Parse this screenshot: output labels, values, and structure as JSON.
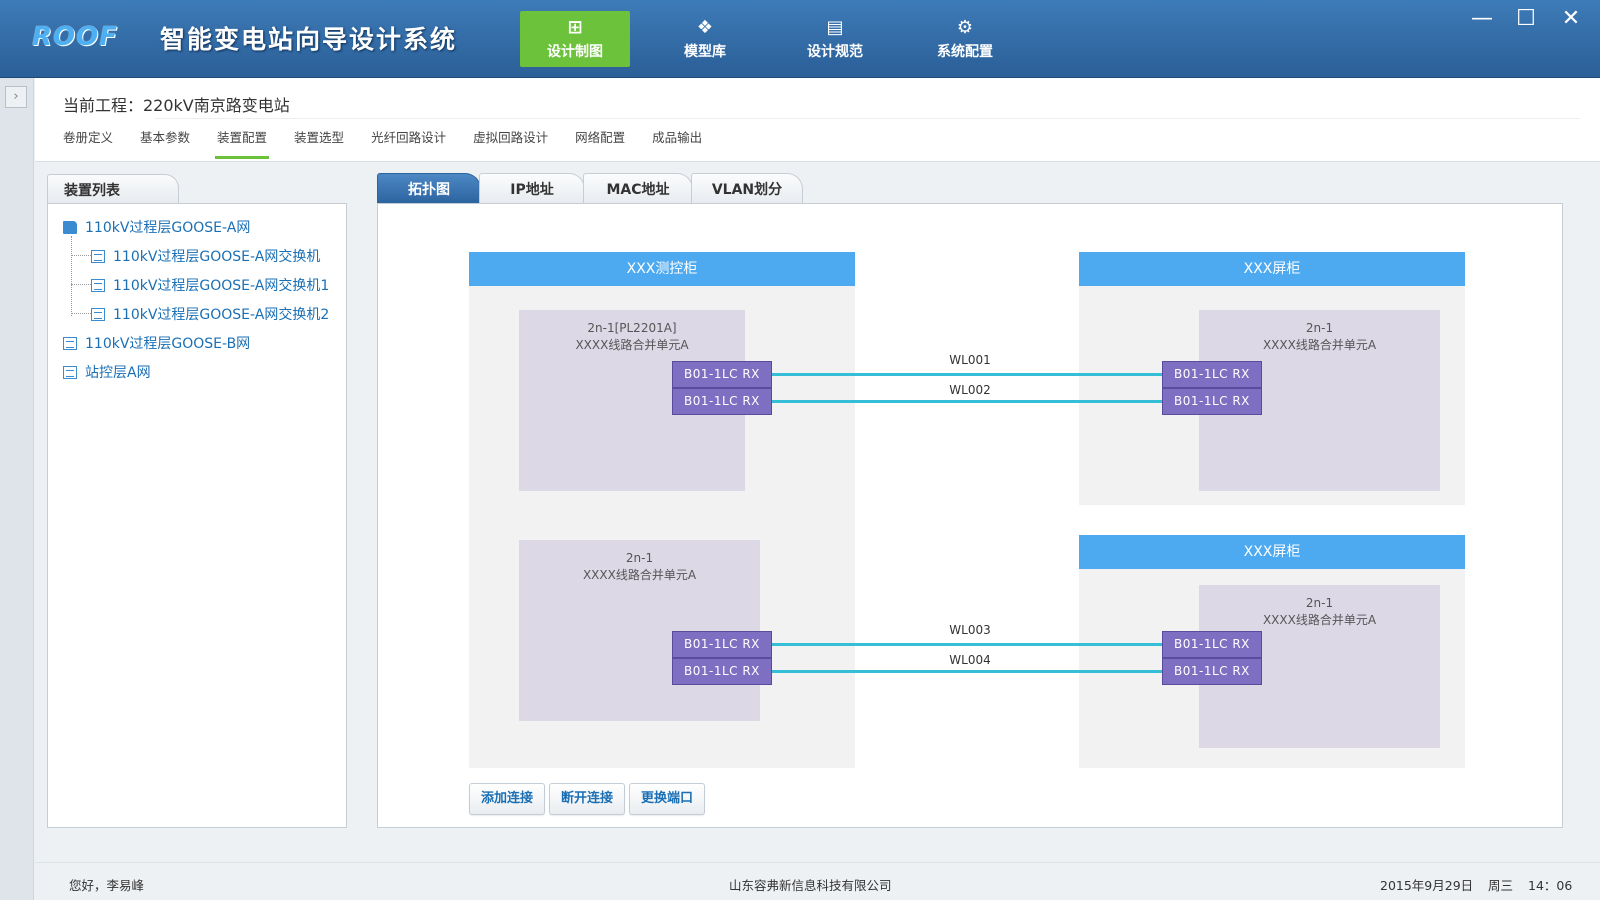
{
  "app": {
    "logo": "ROOF",
    "title": "智能变电站向导设计系统"
  },
  "nav": [
    {
      "label": "设计制图",
      "icon": "design-drawing-icon",
      "glyph": "⊞",
      "active": true
    },
    {
      "label": "模型库",
      "icon": "dropbox-icon",
      "glyph": "❖",
      "active": false
    },
    {
      "label": "设计规范",
      "icon": "document-icon",
      "glyph": "▤",
      "active": false
    },
    {
      "label": "系统配置",
      "icon": "gear-icon",
      "glyph": "⚙",
      "active": false
    }
  ],
  "window_controls": {
    "minimize": "—",
    "maximize": "☐",
    "close": "✕"
  },
  "sidebar_toggle": "›",
  "project": {
    "label": "当前工程：220kV南京路变电站"
  },
  "subtabs": [
    "卷册定义",
    "基本参数",
    "装置配置",
    "装置选型",
    "光纤回路设计",
    "虚拟回路设计",
    "网络配置",
    "成品输出"
  ],
  "subtab_active": "装置配置",
  "left_panel": {
    "title": "装置列表",
    "tree": [
      "110kV过程层GOOSE-A网",
      "110kV过程层GOOSE-A网交换机",
      "110kV过程层GOOSE-A网交换机1",
      "110kV过程层GOOSE-A网交换机2",
      "110kV过程层GOOSE-B网",
      "站控层A网"
    ]
  },
  "right_tabs": [
    "拓扑图",
    "IP地址",
    "MAC地址",
    "VLAN划分"
  ],
  "right_tab_active": "拓扑图",
  "diagram": {
    "cabinets": [
      "XXX测控柜",
      "XXX屏柜",
      "XXX屏柜"
    ],
    "devices": [
      {
        "line1": "2n-1[PL2201A]",
        "line2": "XXXX线路合并单元A"
      },
      {
        "line1": "2n-1",
        "line2": "XXXX线路合并单元A"
      },
      {
        "line1": "2n-1",
        "line2": "XXXX线路合并单元A"
      },
      {
        "line1": "2n-1",
        "line2": "XXXX线路合并单元A"
      }
    ],
    "port_label": "B01-1LC  RX",
    "links": [
      "WL001",
      "WL002",
      "WL003",
      "WL004"
    ],
    "link_color": "#35bfd6",
    "cabinet_header_color": "#4eaaf0",
    "port_color": "#7f6fc3"
  },
  "actions": [
    "添加连接",
    "断开连接",
    "更换端口"
  ],
  "footer": {
    "greeting": "您好，李易峰",
    "company": "山东容弗新信息科技有限公司",
    "date": "2015年9月29日",
    "weekday": "周三",
    "time": "14：06"
  }
}
